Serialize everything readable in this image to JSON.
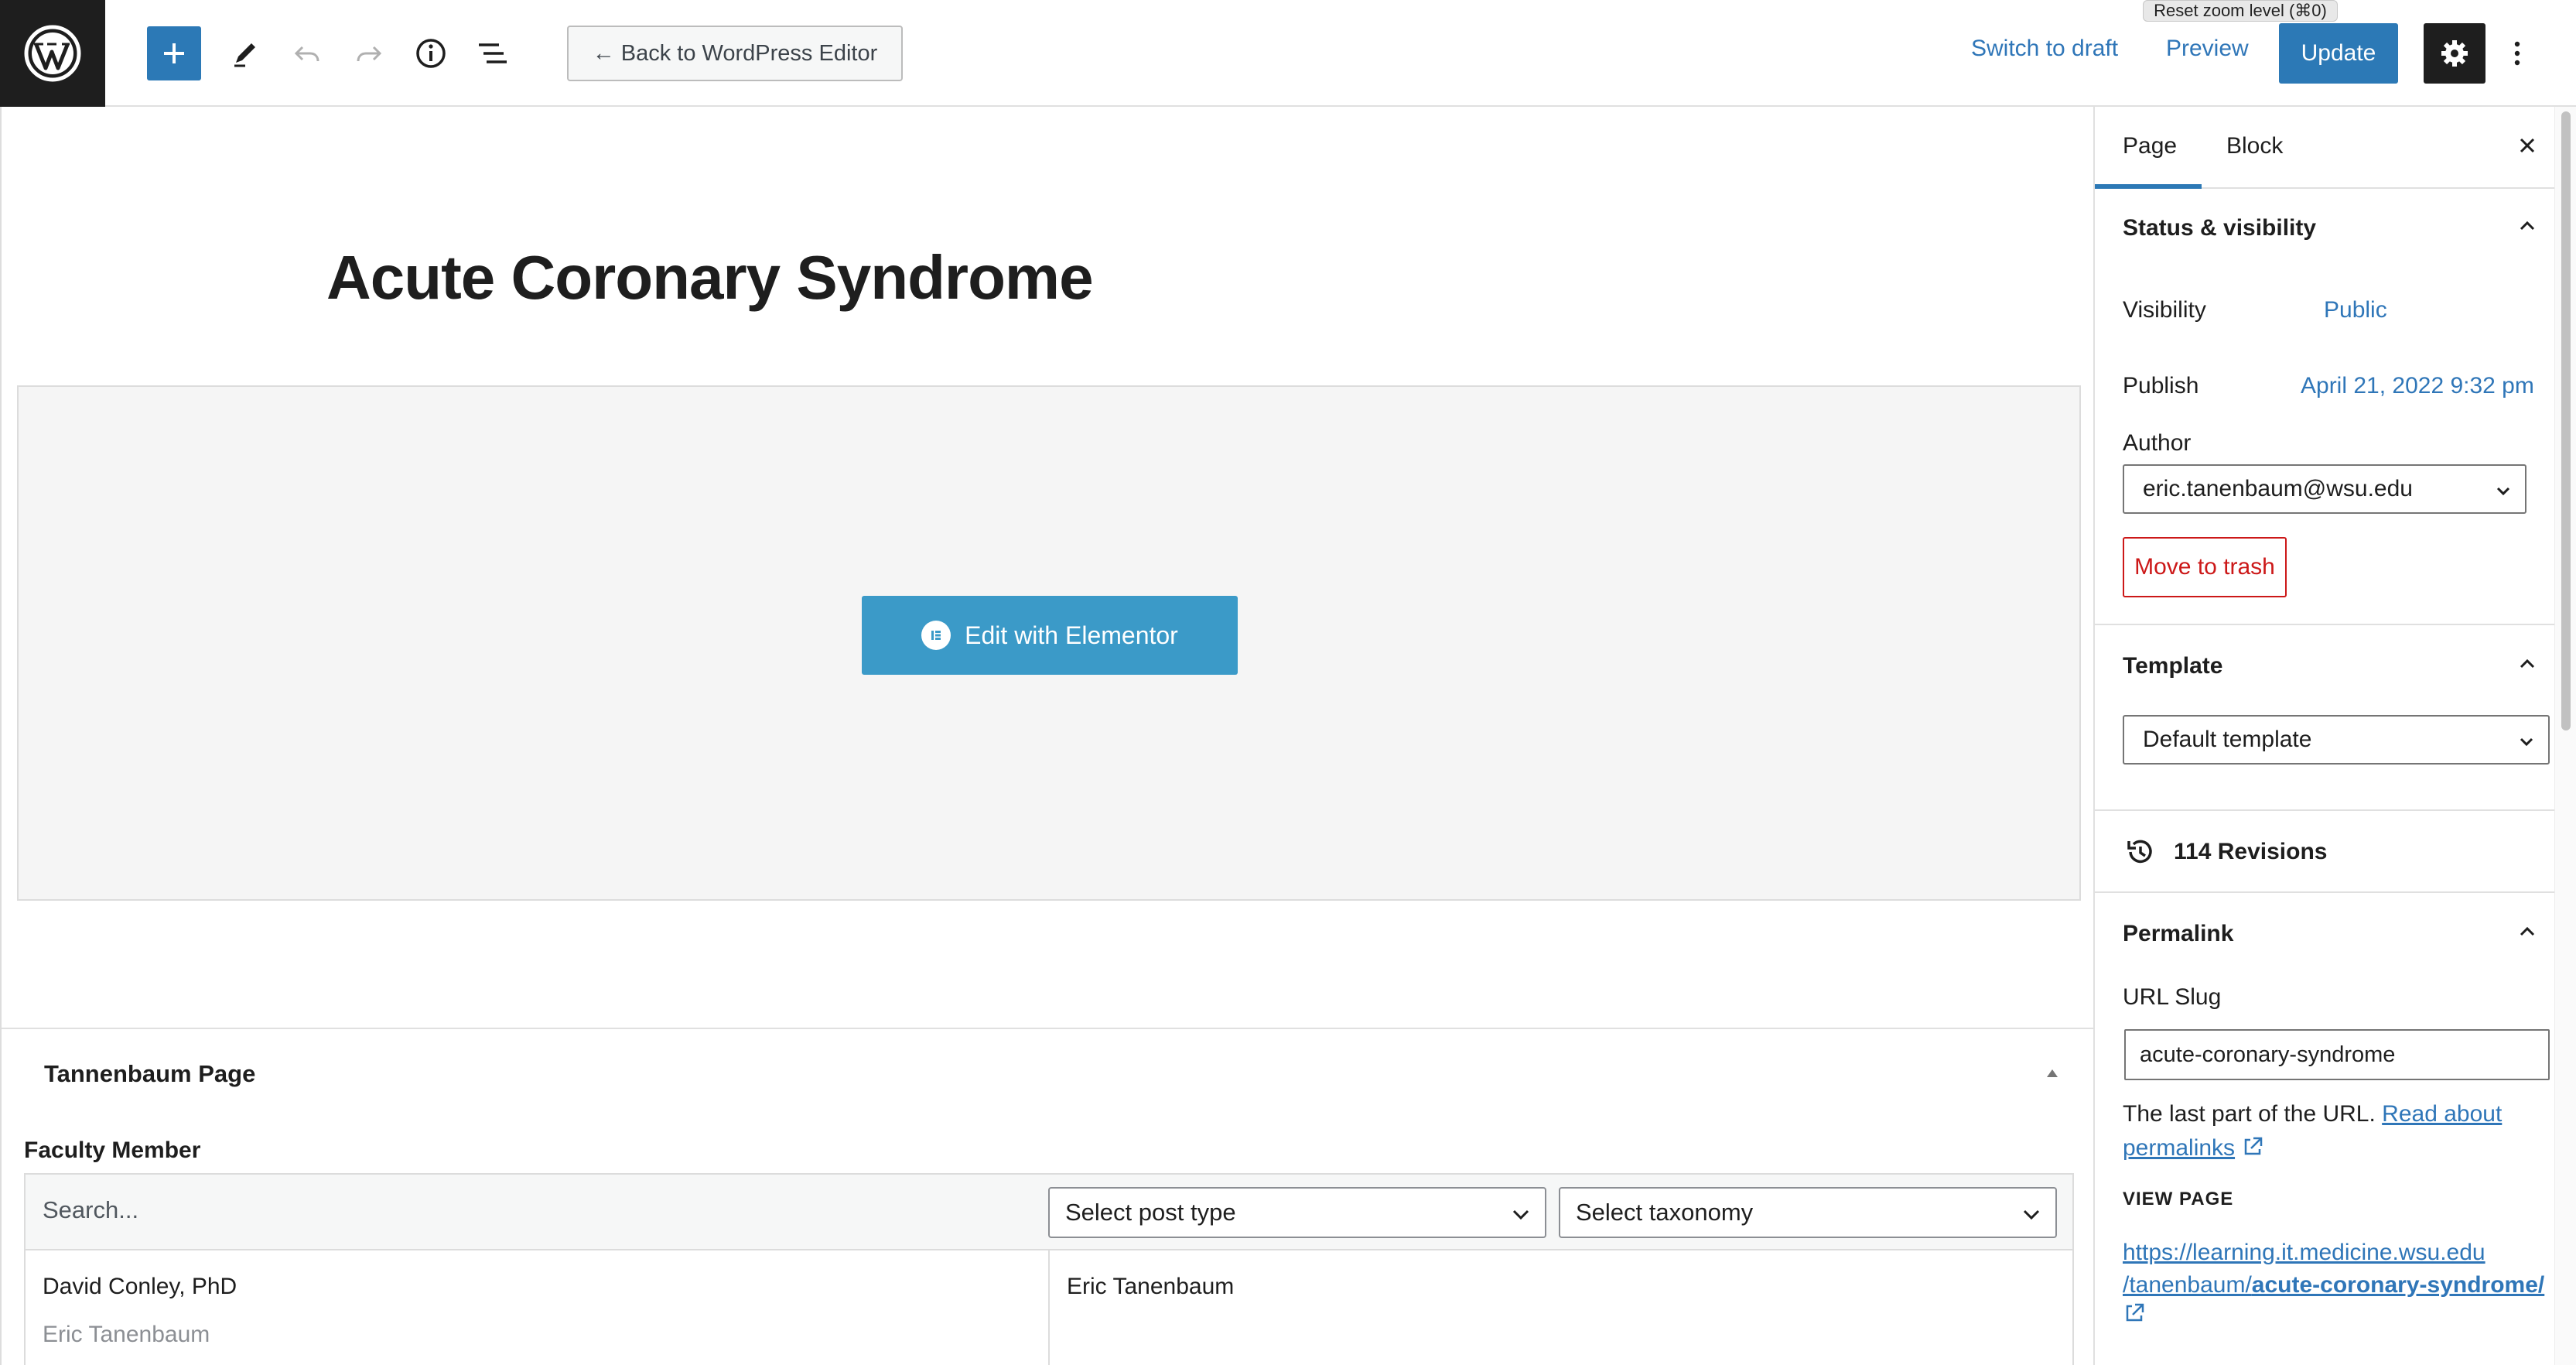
{
  "toolbar": {
    "back_label": "← Back to WordPress Editor",
    "switch_draft": "Switch to draft",
    "preview": "Preview",
    "update": "Update",
    "tooltip": "Reset zoom level (⌘0)"
  },
  "editor": {
    "title": "Acute Coronary Syndrome",
    "elementor_button": "Edit with Elementor"
  },
  "metabox": {
    "title": "Tannenbaum Page",
    "field_label": "Faculty Member",
    "search_placeholder": "Search...",
    "post_type_select": "Select post type",
    "taxonomy_select": "Select taxonomy",
    "choices": [
      {
        "primary": "David Conley, PhD",
        "secondary": "Eric Tanenbaum"
      }
    ],
    "selected": [
      "Eric Tanenbaum"
    ]
  },
  "sidebar": {
    "tabs": [
      "Page",
      "Block"
    ],
    "status_visibility": {
      "heading": "Status & visibility",
      "visibility_label": "Visibility",
      "visibility_value": "Public",
      "publish_label": "Publish",
      "publish_value": "April 21, 2022 9:32 pm",
      "author_label": "Author",
      "author_value": "eric.tanenbaum@wsu.edu",
      "trash": "Move to trash"
    },
    "template": {
      "heading": "Template",
      "value": "Default template"
    },
    "revisions": "114 Revisions",
    "permalink": {
      "heading": "Permalink",
      "slug_label": "URL Slug",
      "slug_value": "acute-coronary-syndrome",
      "help": "The last part of the URL.",
      "help_link": "Read about permalinks",
      "view_page": "VIEW PAGE",
      "url_base": "https://learning.it.medicine.wsu.edu",
      "url_path": "/tanenbaum/",
      "url_slug": "acute-coronary-syndrome/"
    }
  },
  "colors": {
    "accent": "#2c79b6",
    "elementor": "#3b9ac8",
    "danger": "#cc1818",
    "dark": "#1e1e1e"
  }
}
